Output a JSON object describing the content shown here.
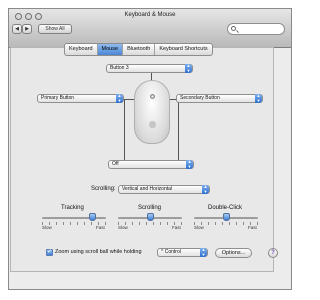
{
  "window": {
    "title": "Keyboard & Mouse",
    "show_all": "Show All",
    "search_placeholder": ""
  },
  "tabs": [
    {
      "label": "Keyboard",
      "active": false
    },
    {
      "label": "Mouse",
      "active": true
    },
    {
      "label": "Bluetooth",
      "active": false
    },
    {
      "label": "Keyboard Shortcuts",
      "active": false
    }
  ],
  "mouse_buttons": {
    "top": "Button 3",
    "left": "Primary Button",
    "right": "Secondary Button",
    "bottom": "Off"
  },
  "scrolling_popup": {
    "label": "Scrolling:",
    "value": "Vertical and Horizontal"
  },
  "sliders": [
    {
      "label": "Tracking",
      "min": "Slow",
      "max": "Fast",
      "level": 0.78
    },
    {
      "label": "Scrolling",
      "min": "Slow",
      "max": "Fast",
      "level": 0.5
    },
    {
      "label": "Double-Click",
      "min": "Slow",
      "max": "Fast",
      "level": 0.5
    }
  ],
  "zoom": {
    "checkbox_label": "Zoom using scroll ball while holding",
    "checked": true,
    "modifier": "^ Control",
    "options_button": "Options..."
  },
  "help": "?",
  "colors": {
    "accent": "#4a86d6"
  }
}
